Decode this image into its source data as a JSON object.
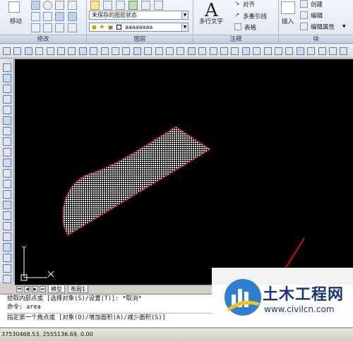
{
  "ribbon": {
    "move_label": "移动",
    "modify_panel": "修改",
    "layer_state": "未保存的图层状态",
    "layer_name": "aaaaaaaa",
    "layer_panel": "图层",
    "mtext_label": "多行文字",
    "align_label": "对齐",
    "mleader_label": "多重引线",
    "table_label": "表格",
    "annotation_panel": "注释",
    "insert_label": "插入",
    "create_label": "创建",
    "edit_label": "编辑",
    "edit_attr_label": "编辑属性",
    "block_panel": "块"
  },
  "layout_tabs": [
    "模型",
    "布局1"
  ],
  "axis": {
    "y": "Y",
    "x": "X"
  },
  "command_lines": [
    "拾取内部点或 [选择对象(S)/设置(T)]: *取消*",
    "命令: area",
    "指定第一个角点或 [对象(O)/增加面积(A)/减少面积(S)]"
  ],
  "status_coords": "37530468.53, 2555136.69, 0.00",
  "watermark": {
    "title": "土木工程网",
    "url": "www.civilcn.com"
  },
  "colors": {
    "canvas": "#000000",
    "hatch_outline": "#e02020",
    "hatch_fill": "#ffffff",
    "red_line": "#d01010"
  }
}
